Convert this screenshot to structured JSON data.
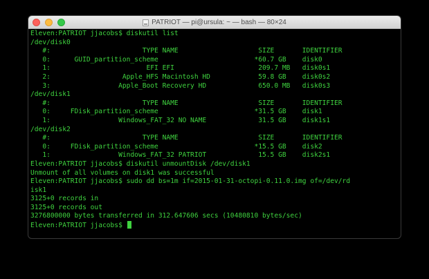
{
  "window": {
    "title": "PATRIOT — pi@ursula: ~ — bash — 80×24",
    "icon": "terminal-document-icon",
    "colors": {
      "text": "#3fd23f",
      "background": "#000000",
      "titlebar": "#e3e3e3"
    }
  },
  "terminal": {
    "lines": [
      "Eleven:PATRIOT jjacobs$ diskutil list",
      "/dev/disk0",
      "   #:                       TYPE NAME                    SIZE       IDENTIFIER",
      "   0:      GUID_partition_scheme                        *60.7 GB    disk0",
      "   1:                        EFI EFI                     209.7 MB   disk0s1",
      "   2:                  Apple_HFS Macintosh HD            59.8 GB    disk0s2",
      "   3:                 Apple_Boot Recovery HD             650.0 MB   disk0s3",
      "/dev/disk1",
      "   #:                       TYPE NAME                    SIZE       IDENTIFIER",
      "   0:     FDisk_partition_scheme                        *31.5 GB    disk1",
      "   1:                 Windows_FAT_32 NO NAME             31.5 GB    disk1s1",
      "/dev/disk2",
      "   #:                       TYPE NAME                    SIZE       IDENTIFIER",
      "   0:     FDisk_partition_scheme                        *15.5 GB    disk2",
      "   1:                 Windows_FAT_32 PATRIOT             15.5 GB    disk2s1",
      "Eleven:PATRIOT jjacobs$ diskutil unmountDisk /dev/disk1",
      "Unmount of all volumes on disk1 was successful",
      "Eleven:PATRIOT jjacobs$ sudo dd bs=1m if=2015-01-31-octopi-0.11.0.img of=/dev/rd",
      "isk1",
      "3125+0 records in",
      "3125+0 records out",
      "3276800000 bytes transferred in 312.647606 secs (10480810 bytes/sec)"
    ],
    "prompt": "Eleven:PATRIOT jjacobs$ "
  }
}
